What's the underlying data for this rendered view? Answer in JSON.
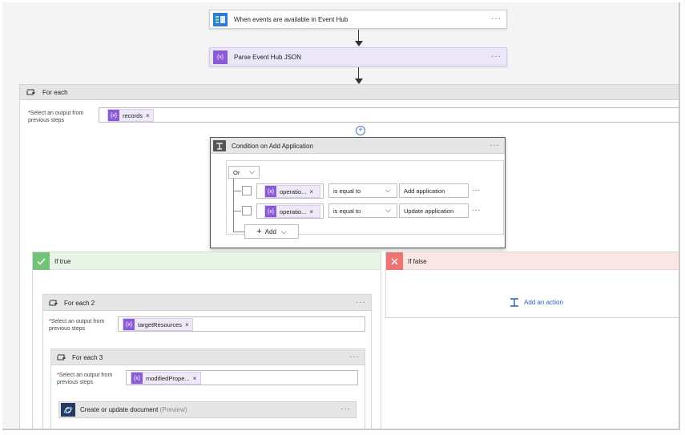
{
  "trigger": {
    "title": "When events are available in Event Hub",
    "more": "···"
  },
  "parse": {
    "title": "Parse Event Hub JSON",
    "more": "···",
    "icon_text": "{x}"
  },
  "foreach1": {
    "title": "For each",
    "select_label_line1": "Select an output from",
    "select_label_line2": "previous steps",
    "required": "*",
    "token": "records"
  },
  "condition": {
    "title": "Condition on Add Application",
    "more": "···",
    "group_op": "Or",
    "rows": [
      {
        "token": "operatio...",
        "operator": "is equal to",
        "value": "Add application",
        "more": "···"
      },
      {
        "token": "operatio...",
        "operator": "is equal to",
        "value": "Update application",
        "more": "···"
      }
    ],
    "add_label": "Add"
  },
  "if_true": {
    "title": "If true"
  },
  "if_false": {
    "title": "If false",
    "add_action": "Add an action"
  },
  "foreach2": {
    "title": "For each 2",
    "more": "···",
    "select_label_line1": "Select an output from",
    "select_label_line2": "previous steps",
    "required": "*",
    "token": "targetResources"
  },
  "foreach3": {
    "title": "For each 3",
    "more": "···",
    "select_label_line1": "Select an output from",
    "select_label_line2": "previous steps",
    "required": "*",
    "token": "modifiedPrope..."
  },
  "document": {
    "title": "Create or update document",
    "suffix": "(Preview)",
    "more": "···"
  },
  "icons": {
    "remove": "×",
    "chevron": "⌵",
    "plus": "+",
    "add_circle": "⊕"
  },
  "colors": {
    "purple": "#8a5bd6",
    "true_green": "#74c27a",
    "false_red": "#f07373",
    "true_bg": "#e8f4e6",
    "false_bg": "#fbe6e6",
    "eventhub_blue": "#2e7cd6",
    "cosmos_dark": "#253a5e"
  }
}
